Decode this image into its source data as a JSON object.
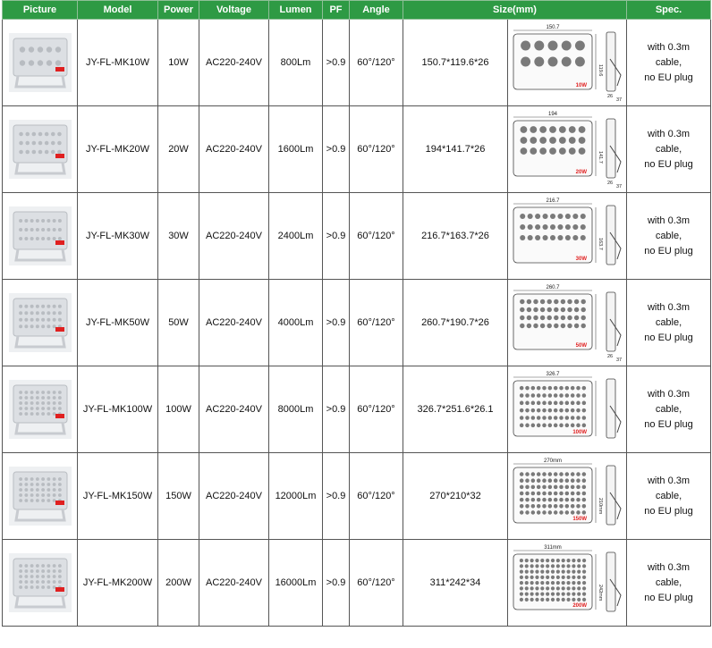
{
  "headers": [
    "Picture",
    "Model",
    "Power",
    "Voltage",
    "Lumen",
    "PF",
    "Angle",
    "Size(mm)",
    "Spec."
  ],
  "colors": {
    "header_bg": "#2e9a44",
    "header_text": "#ffffff",
    "led_gray": "#7a7a7a",
    "badge_red": "#e02020"
  },
  "rows": [
    {
      "model": "JY-FL-MK10W",
      "power": "10W",
      "voltage": "AC220-240V",
      "lumen": "800Lm",
      "pf": ">0.9",
      "angle": "60°/120°",
      "size": "150.7*119.6*26",
      "spec": [
        "with 0.3m",
        "cable,",
        "no EU plug"
      ],
      "led_cols": 5,
      "led_rows": 2,
      "badge": "10W",
      "dims": [
        "150.7",
        "119.6",
        "26",
        "37"
      ],
      "thumb_icon": "floodlight-10w-icon"
    },
    {
      "model": "JY-FL-MK20W",
      "power": "20W",
      "voltage": "AC220-240V",
      "lumen": "1600Lm",
      "pf": ">0.9",
      "angle": "60°/120°",
      "size": "194*141.7*26",
      "spec": [
        "with 0.3m",
        "cable,",
        "no EU plug"
      ],
      "led_cols": 7,
      "led_rows": 3,
      "badge": "20W",
      "dims": [
        "194",
        "141.7",
        "26",
        "37"
      ],
      "thumb_icon": "floodlight-20w-icon"
    },
    {
      "model": "JY-FL-MK30W",
      "power": "30W",
      "voltage": "AC220-240V",
      "lumen": "2400Lm",
      "pf": ">0.9",
      "angle": "60°/120°",
      "size": "216.7*163.7*26",
      "spec": [
        "with 0.3m",
        "cable,",
        "no EU plug"
      ],
      "led_cols": 9,
      "led_rows": 3,
      "badge": "30W",
      "dims": [
        "216.7",
        "163.7",
        "",
        ""
      ],
      "thumb_icon": "floodlight-30w-icon"
    },
    {
      "model": "JY-FL-MK50W",
      "power": "50W",
      "voltage": "AC220-240V",
      "lumen": "4000Lm",
      "pf": ">0.9",
      "angle": "60°/120°",
      "size": "260.7*190.7*26",
      "spec": [
        "with 0.3m",
        "cable,",
        "no EU plug"
      ],
      "led_cols": 10,
      "led_rows": 4,
      "badge": "50W",
      "dims": [
        "260.7",
        "",
        "26",
        "37"
      ],
      "thumb_icon": "floodlight-50w-icon"
    },
    {
      "model": "JY-FL-MK100W",
      "power": "100W",
      "voltage": "AC220-240V",
      "lumen": "8000Lm",
      "pf": ">0.9",
      "angle": "60°/120°",
      "size": "326.7*251.6*26.1",
      "spec": [
        "with 0.3m",
        "cable,",
        "no EU plug"
      ],
      "led_cols": 12,
      "led_rows": 6,
      "badge": "100W",
      "dims": [
        "326.7",
        "",
        "",
        ""
      ],
      "thumb_icon": "floodlight-100w-icon"
    },
    {
      "model": "JY-FL-MK150W",
      "power": "150W",
      "voltage": "AC220-240V",
      "lumen": "12000Lm",
      "pf": ">0.9",
      "angle": "60°/120°",
      "size": "270*210*32",
      "spec": [
        "with 0.3m",
        "cable,",
        "no EU plug"
      ],
      "led_cols": 12,
      "led_rows": 7,
      "badge": "150W",
      "dims": [
        "270mm",
        "210mm",
        "",
        ""
      ],
      "thumb_icon": "floodlight-150w-icon"
    },
    {
      "model": "JY-FL-MK200W",
      "power": "200W",
      "voltage": "AC220-240V",
      "lumen": "16000Lm",
      "pf": ">0.9",
      "angle": "60°/120°",
      "size": "311*242*34",
      "spec": [
        "with 0.3m",
        "cable,",
        "no EU plug"
      ],
      "led_cols": 13,
      "led_rows": 8,
      "badge": "200W",
      "dims": [
        "311mm",
        "242mm",
        "",
        ""
      ],
      "thumb_icon": "floodlight-200w-icon"
    }
  ]
}
